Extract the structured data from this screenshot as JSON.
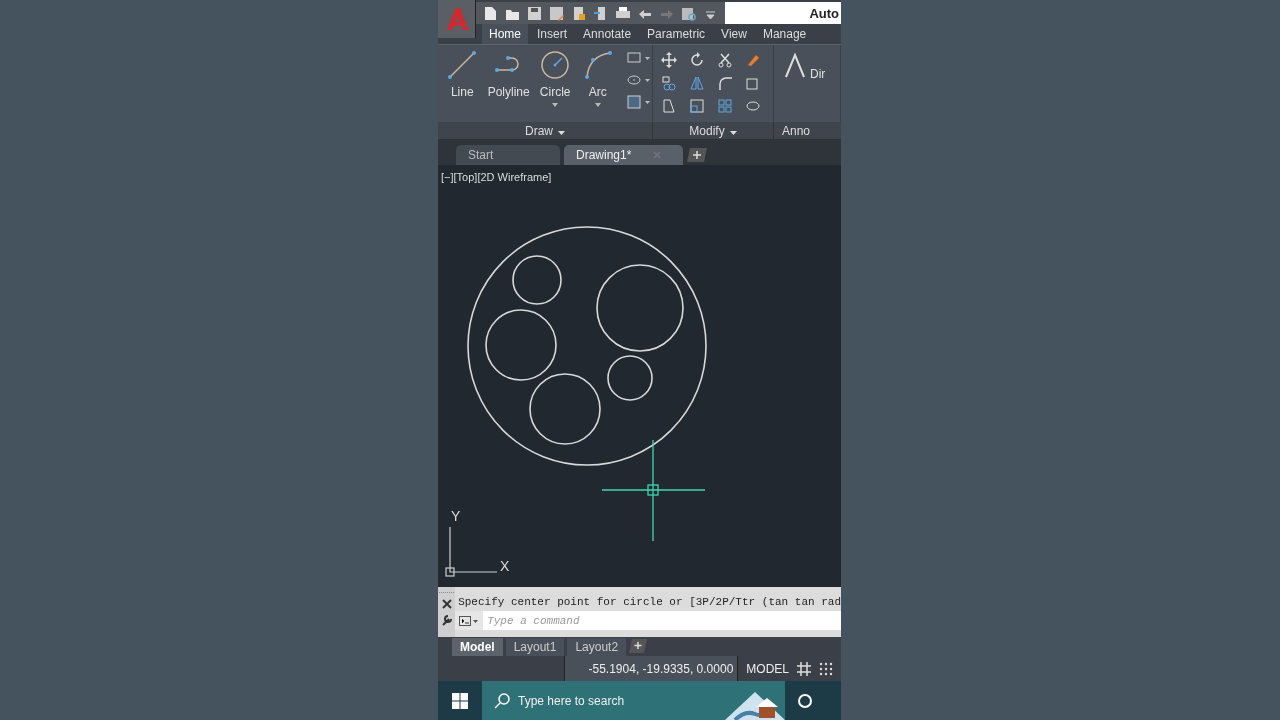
{
  "title_bar": {
    "title": "Auto"
  },
  "ribbon_tabs": [
    {
      "label": "Home",
      "selected": true
    },
    {
      "label": "Insert",
      "selected": false
    },
    {
      "label": "Annotate",
      "selected": false
    },
    {
      "label": "Parametric",
      "selected": false
    },
    {
      "label": "View",
      "selected": false
    },
    {
      "label": "Manage",
      "selected": false
    }
  ],
  "draw_panel": {
    "label": "Draw",
    "tools": [
      {
        "kind": "line",
        "label": "Line"
      },
      {
        "kind": "polyline",
        "label": "Polyline"
      },
      {
        "kind": "circle",
        "label": "Circle"
      },
      {
        "kind": "arc",
        "label": "Arc"
      }
    ]
  },
  "modify_panel": {
    "label": "Modify"
  },
  "annotation_panel": {
    "label": "Anno",
    "tool_label": "Dir"
  },
  "document_tabs": [
    {
      "label": "Start",
      "selected": false
    },
    {
      "label": "Drawing1*",
      "selected": true
    }
  ],
  "viewport": {
    "label": "[−][Top][2D Wireframe]",
    "ucs_y": "Y",
    "ucs_x": "X"
  },
  "command_line": {
    "history": "Specify center point for circle or [3P/2P/Ttr (tan tan rad",
    "placeholder": "Type a command"
  },
  "layout_tabs": [
    {
      "label": "Model",
      "selected": true
    },
    {
      "label": "Layout1",
      "selected": false
    },
    {
      "label": "Layout2",
      "selected": false
    }
  ],
  "status_bar": {
    "coordinates": "-55.1904, -19.9335, 0.0000",
    "space": "MODEL"
  },
  "taskbar": {
    "search_placeholder": "Type here to search"
  }
}
